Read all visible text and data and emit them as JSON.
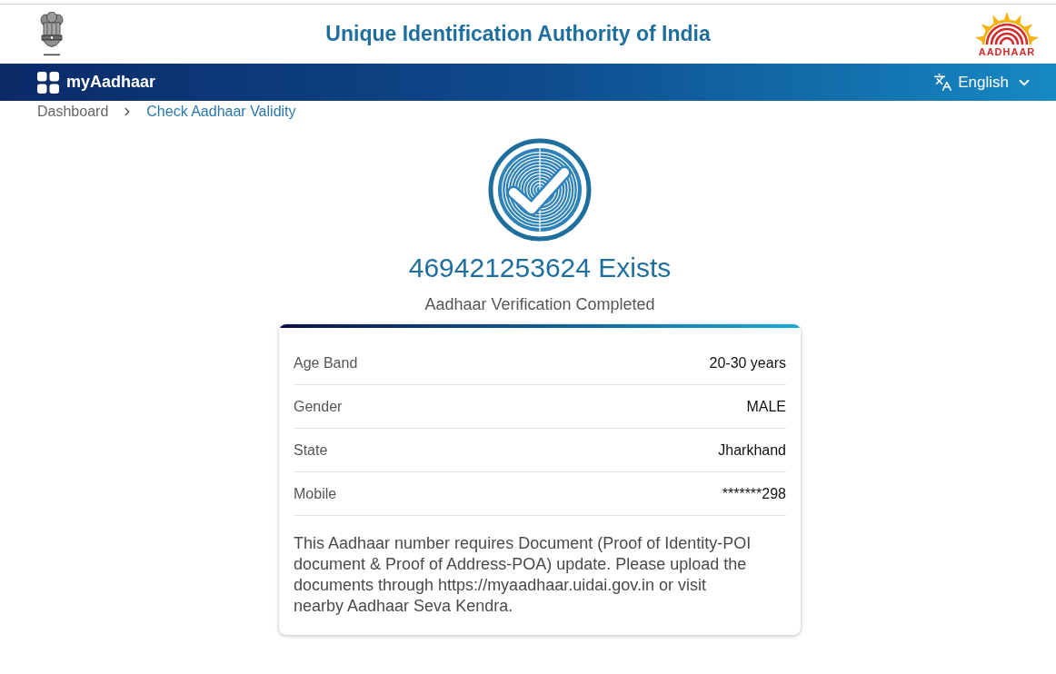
{
  "header": {
    "title": "Unique Identification Authority of India",
    "logo_text": "AADHAAR"
  },
  "navbar": {
    "brand": "myAadhaar",
    "language": "English"
  },
  "breadcrumb": [
    {
      "label": "Dashboard",
      "selected": false
    },
    {
      "label": "Check Aadhaar Validity",
      "selected": true
    }
  ],
  "result": {
    "heading": "469421253624 Exists",
    "subtitle": "Aadhaar Verification Completed"
  },
  "details": [
    {
      "label": "Age Band",
      "value": "20-30 years"
    },
    {
      "label": "Gender",
      "value": "MALE"
    },
    {
      "label": "State",
      "value": "Jharkhand"
    },
    {
      "label": "Mobile",
      "value": "*******298"
    }
  ],
  "notice": "This Aadhaar number requires Document (Proof of Identity-POI document & Proof of Address-POA) update. Please upload the documents through https://myaadhaar.uidai.gov.in or visit nearby Aadhaar Seva Kendra."
}
